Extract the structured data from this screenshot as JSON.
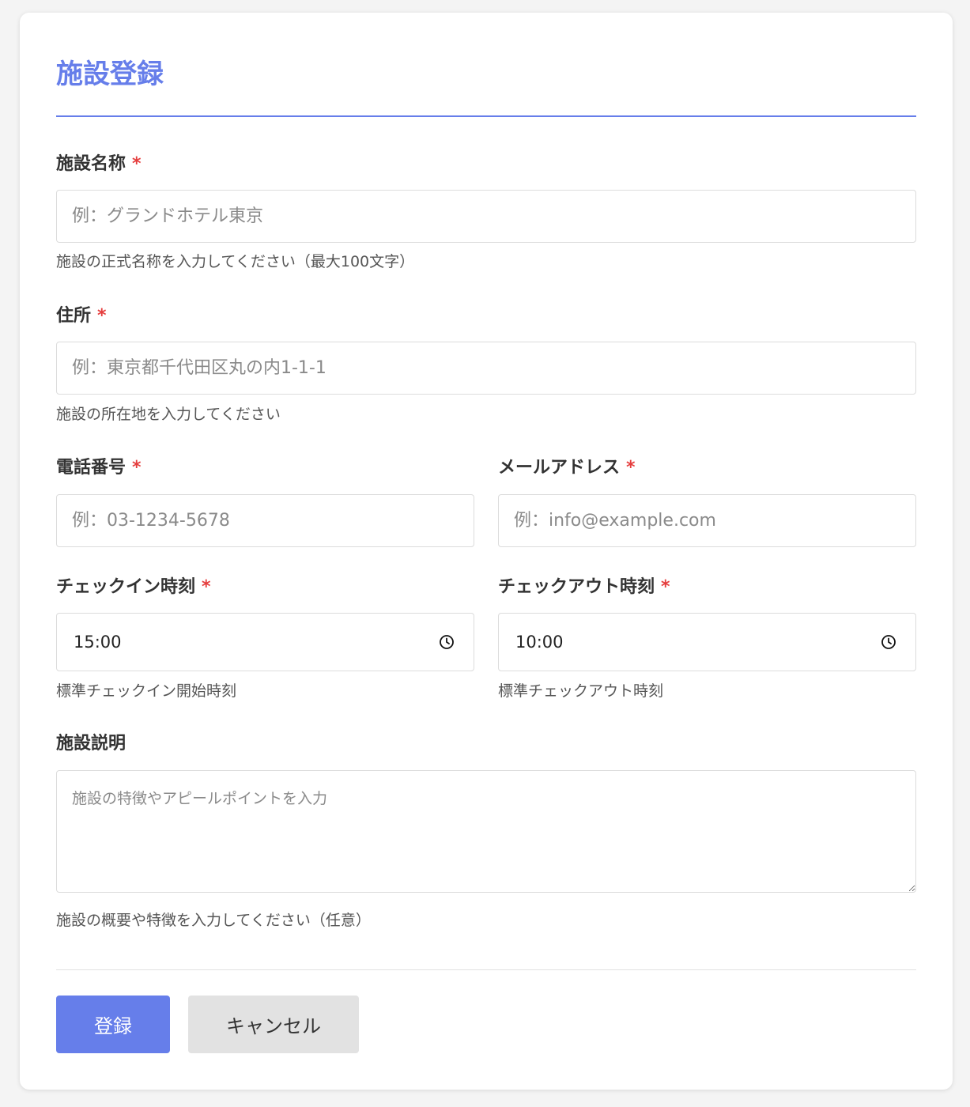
{
  "form": {
    "title": "施設登録",
    "required_mark": "*",
    "name": {
      "label": "施設名称",
      "placeholder": "例：グランドホテル東京",
      "hint": "施設の正式名称を入力してください（最大100文字）"
    },
    "address": {
      "label": "住所",
      "placeholder": "例：東京都千代田区丸の内1-1-1",
      "hint": "施設の所在地を入力してください"
    },
    "phone": {
      "label": "電話番号",
      "placeholder": "例：03-1234-5678"
    },
    "email": {
      "label": "メールアドレス",
      "placeholder": "例：info@example.com"
    },
    "checkin": {
      "label": "チェックイン時刻",
      "value": "15:00",
      "hint": "標準チェックイン開始時刻"
    },
    "checkout": {
      "label": "チェックアウト時刻",
      "value": "10:00",
      "hint": "標準チェックアウト時刻"
    },
    "description": {
      "label": "施設説明",
      "placeholder": "施設の特徴やアピールポイントを入力",
      "hint": "施設の概要や特徴を入力してください（任意）"
    },
    "buttons": {
      "submit": "登録",
      "cancel": "キャンセル"
    }
  },
  "icons": {
    "time": "clock-icon"
  },
  "colors": {
    "accent": "#667eea",
    "required": "#e53e3e",
    "secondary_button": "#e2e2e2"
  }
}
